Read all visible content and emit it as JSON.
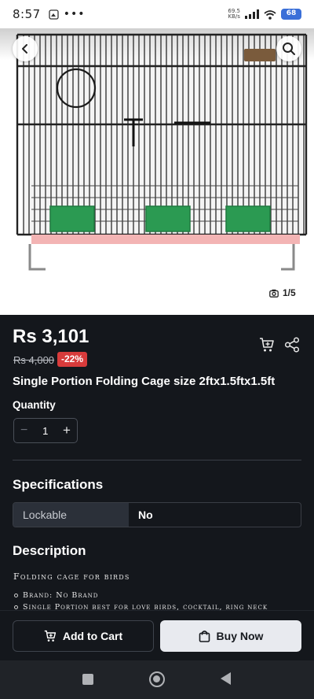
{
  "status_bar": {
    "time": "8:57",
    "network_speed_value": "69.5",
    "network_speed_unit": "KB/s",
    "battery": "68"
  },
  "gallery": {
    "counter": "1/5"
  },
  "product": {
    "price": "Rs 3,101",
    "original_price": "Rs 4,000",
    "discount": "-22%",
    "title": "Single Portion Folding Cage size 2ftx1.5ftx1.5ft"
  },
  "quantity": {
    "label": "Quantity",
    "value": "1",
    "minus": "−",
    "plus": "+"
  },
  "specifications": {
    "heading": "Specifications",
    "rows": [
      {
        "key": "Lockable",
        "value": "No"
      }
    ]
  },
  "description": {
    "heading": "Description",
    "text": "Folding cage for birds",
    "items": [
      "Brand: No Brand",
      "Single Portion best for love birds, cocktail, ring neck"
    ]
  },
  "actions": {
    "add_to_cart": "Add to Cart",
    "buy_now": "Buy Now"
  },
  "colors": {
    "background": "#14171c",
    "discount_badge": "#d83b3b",
    "buy_now_bg": "#e8eaef"
  }
}
